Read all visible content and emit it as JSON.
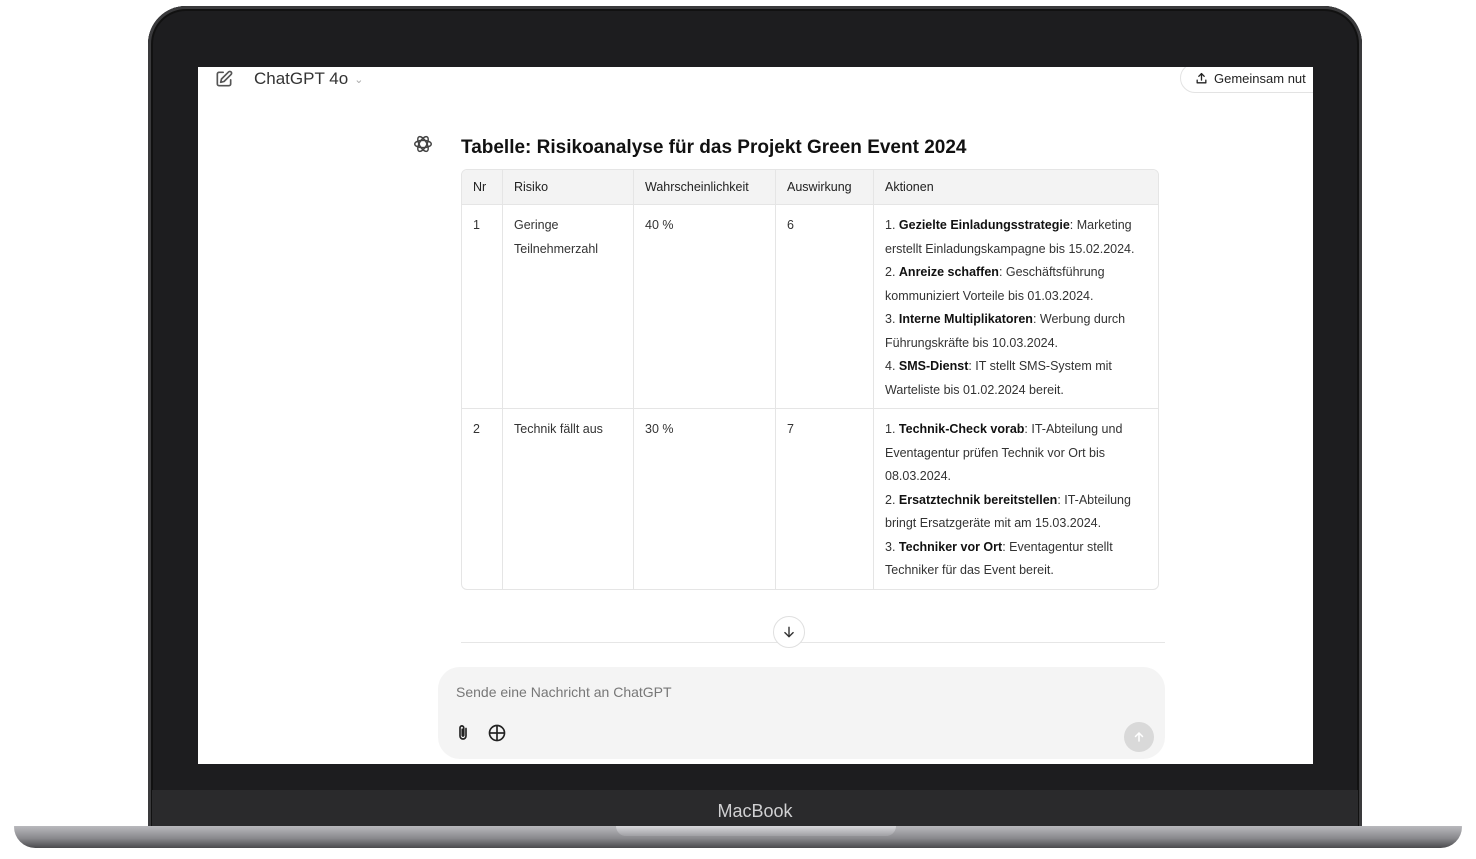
{
  "device": {
    "brand_label": "MacBook"
  },
  "header": {
    "model_name": "ChatGPT 4o",
    "share_label": "Gemeinsam nut"
  },
  "message": {
    "title": "Tabelle: Risikoanalyse für das Projekt Green Event 2024",
    "table": {
      "columns": [
        "Nr",
        "Risiko",
        "Wahrscheinlichkeit",
        "Auswirkung",
        "Aktionen"
      ],
      "rows": [
        {
          "nr": "1",
          "risk": "Geringe Teilnehmerzahl",
          "probability": "40 %",
          "impact": "6",
          "actions": [
            {
              "prefix": "1. ",
              "bold": "Gezielte Einladungsstrategie",
              "text": ": Marketing erstellt Einladungskampagne bis 15.02.2024."
            },
            {
              "prefix": "2. ",
              "bold": "Anreize schaffen",
              "text": ": Geschäftsführung kommuniziert Vorteile bis 01.03.2024."
            },
            {
              "prefix": "3. ",
              "bold": "Interne Multiplikatoren",
              "text": ": Werbung durch Führungskräfte bis 10.03.2024."
            },
            {
              "prefix": "4. ",
              "bold": "SMS-Dienst",
              "text": ": IT stellt SMS-System mit Warteliste bis 01.02.2024 bereit."
            }
          ]
        },
        {
          "nr": "2",
          "risk": "Technik fällt aus",
          "probability": "30 %",
          "impact": "7",
          "actions": [
            {
              "prefix": "1. ",
              "bold": "Technik-Check vorab",
              "text": ": IT-Abteilung und Eventagentur prüfen Technik vor Ort bis 08.03.2024."
            },
            {
              "prefix": "2. ",
              "bold": "Ersatztechnik bereitstellen",
              "text": ": IT-Abteilung bringt Ersatzgeräte mit am 15.03.2024."
            },
            {
              "prefix": "3. ",
              "bold": "Techniker vor Ort",
              "text": ": Eventagentur stellt Techniker für das Event bereit."
            }
          ]
        }
      ]
    }
  },
  "composer": {
    "placeholder": "Sende eine Nachricht an ChatGPT",
    "value": ""
  },
  "icons": {
    "new_chat": "edit-icon",
    "share": "upload-icon",
    "avatar": "openai-logo-icon",
    "scroll": "arrow-down-icon",
    "attach": "paperclip-icon",
    "web": "globe-icon",
    "send": "arrow-up-icon"
  }
}
